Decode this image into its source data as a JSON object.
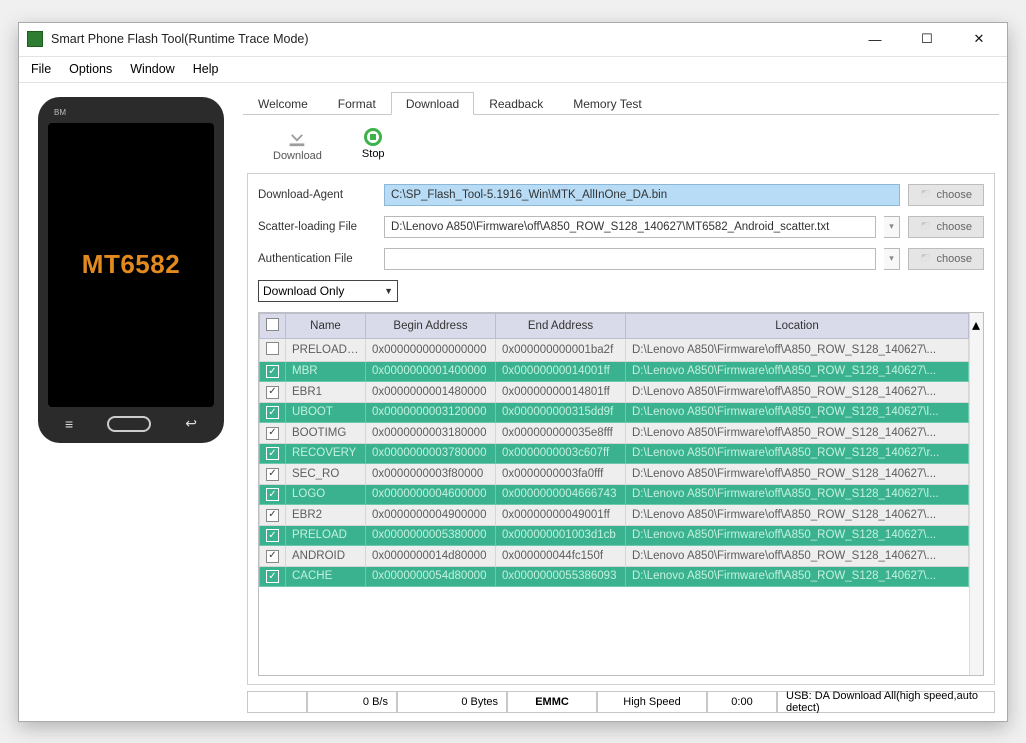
{
  "window": {
    "title": "Smart Phone Flash Tool(Runtime Trace Mode)"
  },
  "menu": [
    "File",
    "Options",
    "Window",
    "Help"
  ],
  "phone": {
    "brand": "BM",
    "chip": "MT6582"
  },
  "tabs": [
    "Welcome",
    "Format",
    "Download",
    "Readback",
    "Memory Test"
  ],
  "active_tab": "Download",
  "actions": {
    "download": "Download",
    "stop": "Stop"
  },
  "files": {
    "da_label": "Download-Agent",
    "da_value": "C:\\SP_Flash_Tool-5.1916_Win\\MTK_AllInOne_DA.bin",
    "scatter_label": "Scatter-loading File",
    "scatter_value": "D:\\Lenovo A850\\Firmware\\off\\A850_ROW_S128_140627\\MT6582_Android_scatter.txt",
    "auth_label": "Authentication File",
    "auth_value": "",
    "choose": "choose"
  },
  "mode": "Download Only",
  "columns": {
    "cb": "",
    "name": "Name",
    "begin": "Begin Address",
    "end": "End Address",
    "loc": "Location"
  },
  "rows": [
    {
      "checked": false,
      "green": false,
      "name": "PRELOADER",
      "begin": "0x0000000000000000",
      "end": "0x000000000001ba2f",
      "loc": "D:\\Lenovo A850\\Firmware\\off\\A850_ROW_S128_140627\\..."
    },
    {
      "checked": true,
      "green": true,
      "name": "MBR",
      "begin": "0x0000000001400000",
      "end": "0x00000000014001ff",
      "loc": "D:\\Lenovo A850\\Firmware\\off\\A850_ROW_S128_140627\\..."
    },
    {
      "checked": true,
      "green": false,
      "name": "EBR1",
      "begin": "0x0000000001480000",
      "end": "0x00000000014801ff",
      "loc": "D:\\Lenovo A850\\Firmware\\off\\A850_ROW_S128_140627\\..."
    },
    {
      "checked": true,
      "green": true,
      "name": "UBOOT",
      "begin": "0x0000000003120000",
      "end": "0x000000000315dd9f",
      "loc": "D:\\Lenovo A850\\Firmware\\off\\A850_ROW_S128_140627\\l..."
    },
    {
      "checked": true,
      "green": false,
      "name": "BOOTIMG",
      "begin": "0x0000000003180000",
      "end": "0x000000000035e8fff",
      "loc": "D:\\Lenovo A850\\Firmware\\off\\A850_ROW_S128_140627\\..."
    },
    {
      "checked": true,
      "green": true,
      "name": "RECOVERY",
      "begin": "0x0000000003780000",
      "end": "0x0000000003c607ff",
      "loc": "D:\\Lenovo A850\\Firmware\\off\\A850_ROW_S128_140627\\r..."
    },
    {
      "checked": true,
      "green": false,
      "name": "SEC_RO",
      "begin": "0x0000000003f80000",
      "end": "0x0000000003fa0fff",
      "loc": "D:\\Lenovo A850\\Firmware\\off\\A850_ROW_S128_140627\\..."
    },
    {
      "checked": true,
      "green": true,
      "name": "LOGO",
      "begin": "0x0000000004600000",
      "end": "0x0000000004666743",
      "loc": "D:\\Lenovo A850\\Firmware\\off\\A850_ROW_S128_140627\\l..."
    },
    {
      "checked": true,
      "green": false,
      "name": "EBR2",
      "begin": "0x0000000004900000",
      "end": "0x00000000049001ff",
      "loc": "D:\\Lenovo A850\\Firmware\\off\\A850_ROW_S128_140627\\..."
    },
    {
      "checked": true,
      "green": true,
      "name": "PRELOAD",
      "begin": "0x0000000005380000",
      "end": "0x000000001003d1cb",
      "loc": "D:\\Lenovo A850\\Firmware\\off\\A850_ROW_S128_140627\\..."
    },
    {
      "checked": true,
      "green": false,
      "name": "ANDROID",
      "begin": "0x0000000014d80000",
      "end": "0x000000044fc150f",
      "loc": "D:\\Lenovo A850\\Firmware\\off\\A850_ROW_S128_140627\\..."
    },
    {
      "checked": true,
      "green": true,
      "name": "CACHE",
      "begin": "0x0000000054d80000",
      "end": "0x0000000055386093",
      "loc": "D:\\Lenovo A850\\Firmware\\off\\A850_ROW_S128_140627\\..."
    }
  ],
  "status": {
    "speed": "0 B/s",
    "bytes": "0 Bytes",
    "storage": "EMMC",
    "mode": "High Speed",
    "time": "0:00",
    "usb": "USB: DA Download All(high speed,auto detect)"
  }
}
